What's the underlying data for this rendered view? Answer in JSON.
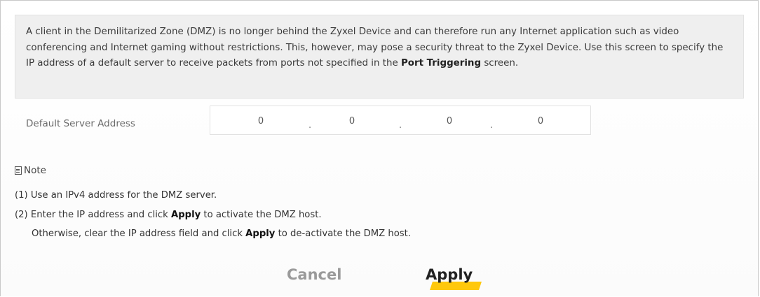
{
  "description": {
    "text_before": "A client in the Demilitarized Zone (DMZ) is no longer behind the Zyxel Device and can therefore run any Internet application such as video conferencing and Internet gaming without restrictions. This, however, may pose a security threat to the Zyxel Device. Use this screen to specify the IP address of a default server to receive packets from ports not specified in the ",
    "bold_text": "Port Triggering",
    "text_after": " screen."
  },
  "form": {
    "default_server_label": "Default Server Address",
    "ip_octets": [
      "0",
      "0",
      "0",
      "0"
    ],
    "separator": "."
  },
  "note": {
    "heading": "Note",
    "line1": "(1) Use an IPv4 address for the DMZ server.",
    "line2_prefix": "(2) Enter the IP address and click ",
    "line2_bold": "Apply",
    "line2_suffix": " to activate the DMZ host.",
    "line3_prefix": "Otherwise, clear the IP address field and click ",
    "line3_bold": "Apply",
    "line3_suffix": " to de-activate the DMZ host."
  },
  "buttons": {
    "cancel": "Cancel",
    "apply": "Apply"
  },
  "colors": {
    "apply_highlight": "#ffc80c",
    "description_bg": "#efefef"
  }
}
